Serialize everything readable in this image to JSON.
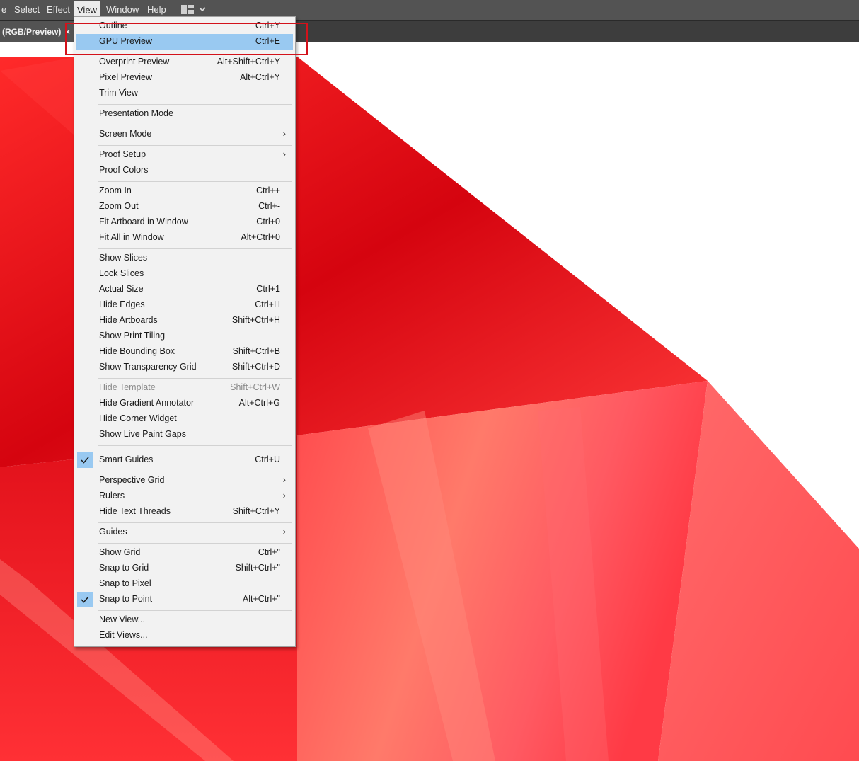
{
  "menubar": {
    "items": [
      {
        "label": "e",
        "active": false
      },
      {
        "label": "Select",
        "active": false
      },
      {
        "label": "Effect",
        "active": false
      },
      {
        "label": "View",
        "active": true
      },
      {
        "label": "Window",
        "active": false
      },
      {
        "label": "Help",
        "active": false
      }
    ],
    "workspace_icon": "workspace-layout-icon",
    "workspace_chevron": "chevron-down-icon"
  },
  "tab": {
    "title": "(RGB/Preview)",
    "close_glyph": "×"
  },
  "view_menu": {
    "items": [
      {
        "label": "Outline",
        "shortcut": "Ctrl+Y"
      },
      {
        "label": "GPU Preview",
        "shortcut": "Ctrl+E",
        "highlighted": true
      },
      {
        "label": "Overprint Preview",
        "shortcut": "Alt+Shift+Ctrl+Y"
      },
      {
        "label": "Pixel Preview",
        "shortcut": "Alt+Ctrl+Y"
      },
      {
        "label": "Trim View",
        "shortcut": ""
      },
      {
        "label": "Presentation Mode",
        "shortcut": ""
      },
      {
        "label": "Screen Mode",
        "shortcut": "",
        "submenu": true
      },
      {
        "label": "Proof Setup",
        "shortcut": "",
        "submenu": true
      },
      {
        "label": "Proof Colors",
        "shortcut": ""
      },
      {
        "label": "Zoom In",
        "shortcut": "Ctrl++"
      },
      {
        "label": "Zoom Out",
        "shortcut": "Ctrl+-"
      },
      {
        "label": "Fit Artboard in Window",
        "shortcut": "Ctrl+0"
      },
      {
        "label": "Fit All in Window",
        "shortcut": "Alt+Ctrl+0"
      },
      {
        "label": "Show Slices",
        "shortcut": ""
      },
      {
        "label": "Lock Slices",
        "shortcut": ""
      },
      {
        "label": "Actual Size",
        "shortcut": "Ctrl+1"
      },
      {
        "label": "Hide Edges",
        "shortcut": "Ctrl+H"
      },
      {
        "label": "Hide Artboards",
        "shortcut": "Shift+Ctrl+H"
      },
      {
        "label": "Show Print Tiling",
        "shortcut": ""
      },
      {
        "label": "Hide Bounding Box",
        "shortcut": "Shift+Ctrl+B"
      },
      {
        "label": "Show Transparency Grid",
        "shortcut": "Shift+Ctrl+D"
      },
      {
        "label": "Hide Template",
        "shortcut": "Shift+Ctrl+W",
        "disabled": true
      },
      {
        "label": "Hide Gradient Annotator",
        "shortcut": "Alt+Ctrl+G"
      },
      {
        "label": "Hide Corner Widget",
        "shortcut": ""
      },
      {
        "label": "Show Live Paint Gaps",
        "shortcut": ""
      },
      {
        "label": "Smart Guides",
        "shortcut": "Ctrl+U",
        "checked": true
      },
      {
        "label": "Perspective Grid",
        "shortcut": "",
        "submenu": true
      },
      {
        "label": "Rulers",
        "shortcut": "",
        "submenu": true
      },
      {
        "label": "Hide Text Threads",
        "shortcut": "Shift+Ctrl+Y"
      },
      {
        "label": "Guides",
        "shortcut": "",
        "submenu": true
      },
      {
        "label": "Show Grid",
        "shortcut": "Ctrl+\""
      },
      {
        "label": "Snap to Grid",
        "shortcut": "Shift+Ctrl+\""
      },
      {
        "label": "Snap to Pixel",
        "shortcut": ""
      },
      {
        "label": "Snap to Point",
        "shortcut": "Alt+Ctrl+\"",
        "checked": true
      },
      {
        "label": "New View...",
        "shortcut": ""
      },
      {
        "label": "Edit Views...",
        "shortcut": ""
      }
    ],
    "submenu_glyph": "›",
    "check_icon": "checkmark-icon"
  },
  "colors": {
    "highlight": "#99c9f1",
    "annotation": "#d3121b",
    "artwork_red": "#e8121c"
  }
}
